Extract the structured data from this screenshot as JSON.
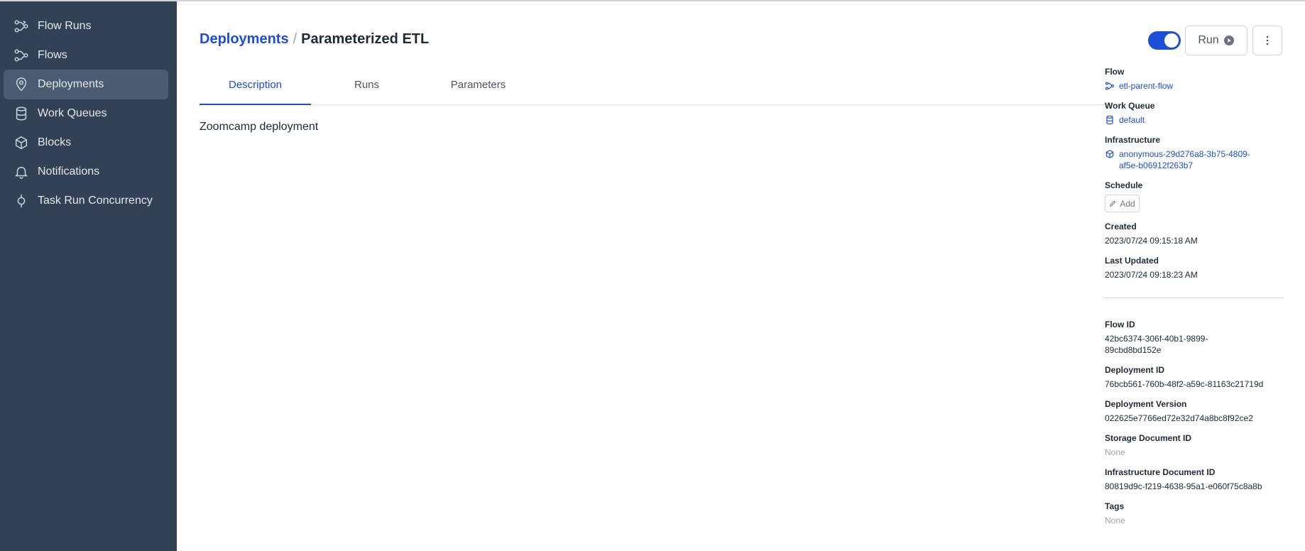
{
  "sidebar": {
    "items": [
      {
        "label": "Flow Runs",
        "icon": "flow-runs-icon"
      },
      {
        "label": "Flows",
        "icon": "flows-icon"
      },
      {
        "label": "Deployments",
        "icon": "map-pin-icon"
      },
      {
        "label": "Work Queues",
        "icon": "database-icon"
      },
      {
        "label": "Blocks",
        "icon": "cube-icon"
      },
      {
        "label": "Notifications",
        "icon": "bell-icon"
      },
      {
        "label": "Task Run Concurrency",
        "icon": "concurrency-icon"
      }
    ],
    "active_index": 2
  },
  "header": {
    "breadcrumb_root": "Deployments",
    "breadcrumb_sep": "/",
    "title": "Parameterized ETL",
    "toggle_on": true,
    "run_label": "Run"
  },
  "tabs": [
    {
      "label": "Description",
      "active": true
    },
    {
      "label": "Runs",
      "active": false
    },
    {
      "label": "Parameters",
      "active": false
    }
  ],
  "description": "Zoomcamp deployment",
  "details": {
    "flow_label": "Flow",
    "flow_value": "etl-parent-flow",
    "work_queue_label": "Work Queue",
    "work_queue_value": "default",
    "infrastructure_label": "Infrastructure",
    "infrastructure_line1": "anonymous-29d276a8-3b75-4809-",
    "infrastructure_line2": "af5e-b06912f263b7",
    "schedule_label": "Schedule",
    "schedule_add": "Add",
    "created_label": "Created",
    "created_value": "2023/07/24 09:15:18 AM",
    "updated_label": "Last Updated",
    "updated_value": "2023/07/24 09:18:23 AM",
    "flow_id_label": "Flow ID",
    "flow_id_line1": "42bc6374-306f-40b1-9899-",
    "flow_id_line2": "89cbd8bd152e",
    "deployment_id_label": "Deployment ID",
    "deployment_id_value": "76bcb561-760b-48f2-a59c-81163c21719d",
    "deployment_version_label": "Deployment Version",
    "deployment_version_value": "022625e7766ed72e32d74a8bc8f92ce2",
    "storage_doc_label": "Storage Document ID",
    "storage_doc_value": "None",
    "infra_doc_label": "Infrastructure Document ID",
    "infra_doc_value": "80819d9c-f219-4638-95a1-e060f75c8a8b",
    "tags_label": "Tags",
    "tags_value": "None"
  },
  "colors": {
    "sidebar_bg": "#334155",
    "accent": "#1d4ed8",
    "muted": "#9ca3af"
  }
}
